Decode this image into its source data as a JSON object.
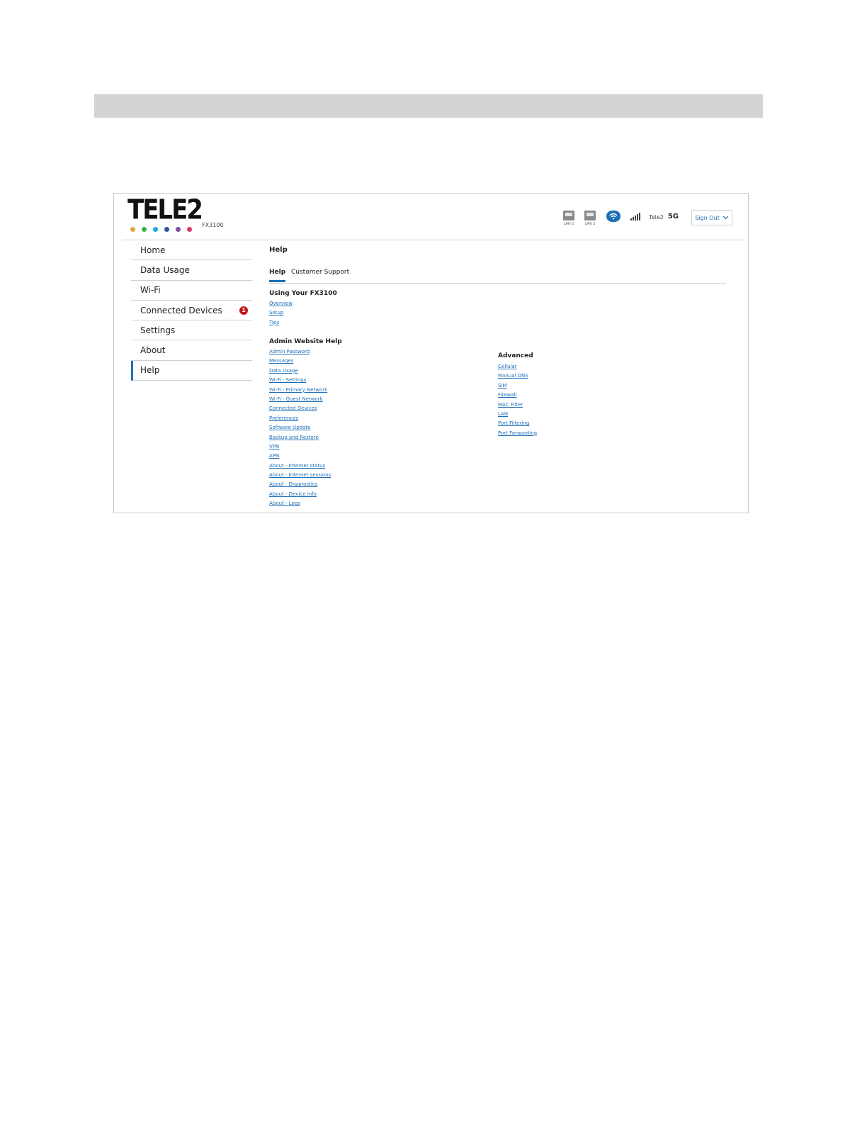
{
  "brand": {
    "logo_text": "TELE2",
    "model": "FX3100",
    "dot_colors": [
      "#e3a53a",
      "#35b24a",
      "#18aee0",
      "#2a54a6",
      "#7a4fa3",
      "#d83a6e"
    ]
  },
  "status": {
    "lan1_label": "LAN 1",
    "lan2_label": "LAN 2",
    "carrier": "Tele2",
    "network": "5G",
    "signout_label": "Sign Out"
  },
  "sidebar": {
    "items": [
      {
        "label": "Home"
      },
      {
        "label": "Data Usage"
      },
      {
        "label": "Wi-Fi"
      },
      {
        "label": "Connected Devices",
        "badge": "1"
      },
      {
        "label": "Settings"
      },
      {
        "label": "About"
      },
      {
        "label": "Help",
        "active": true
      }
    ]
  },
  "main": {
    "title": "Help",
    "tabs": [
      {
        "label": "Help",
        "active": true
      },
      {
        "label": "Customer Support"
      }
    ],
    "sections": {
      "using": {
        "heading": "Using Your FX3100",
        "links": [
          "Overview",
          "Setup",
          "Tips"
        ]
      },
      "admin": {
        "heading": "Admin Website Help",
        "links": [
          "Admin Password",
          "Messages",
          "Data Usage",
          "Wi-Fi - Settings",
          "Wi-Fi - Primary Network",
          "Wi-Fi - Guest Network",
          "Connected Devices",
          "Preferences",
          "Software Update",
          "Backup and Restore",
          "VPN",
          "APN",
          "About - Internet status",
          "About - Internet sessions",
          "About - Diagnostics",
          "About - Device info",
          "About - Logs"
        ]
      },
      "advanced": {
        "heading": "Advanced",
        "links": [
          "Cellular",
          "Manual DNS",
          "SIM",
          "Firewall",
          "MAC Filter",
          "LAN",
          "Port Filtering",
          "Port Forwarding"
        ]
      }
    }
  },
  "colors": {
    "accent": "#1d6fb8",
    "badge": "#c0161d"
  }
}
